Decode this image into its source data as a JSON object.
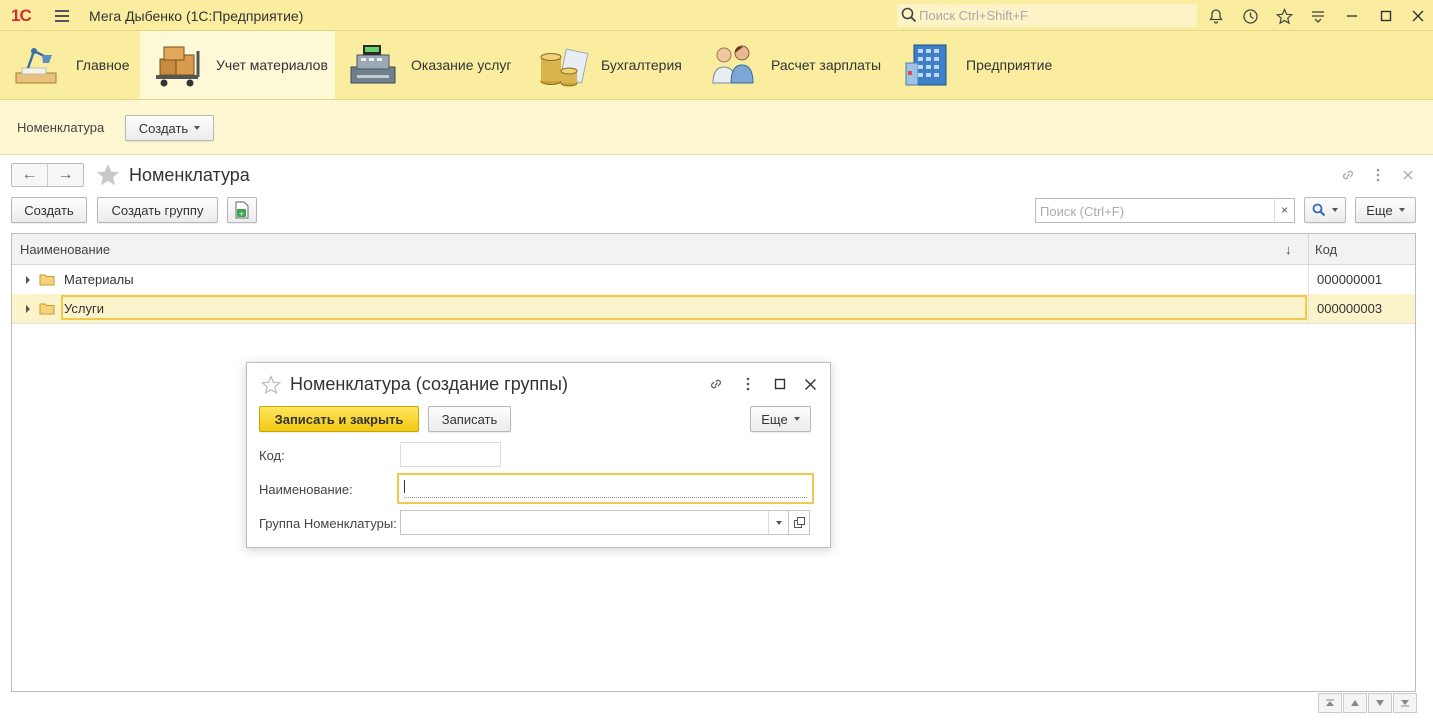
{
  "titlebar": {
    "logo": "1С",
    "title": "Мега Дыбенко  (1С:Предприятие)",
    "search_placeholder": "Поиск Ctrl+Shift+F"
  },
  "sections": [
    {
      "label": "Главное",
      "icon": "desk-lamp-icon"
    },
    {
      "label": "Учет материалов",
      "icon": "boxes-cart-icon",
      "active": true
    },
    {
      "label": "Оказание услуг",
      "icon": "cash-register-icon"
    },
    {
      "label": "Бухгалтерия",
      "icon": "coins-icon"
    },
    {
      "label": "Расчет зарплаты",
      "icon": "people-icon"
    },
    {
      "label": "Предприятие",
      "icon": "building-icon"
    }
  ],
  "subbar": {
    "link": "Номенклатура",
    "create_label": "Создать"
  },
  "form": {
    "title": "Номенклатура",
    "create_label": "Создать",
    "create_group_label": "Создать группу",
    "search_placeholder": "Поиск (Ctrl+F)",
    "clear_label": "×",
    "more_label": "Еще"
  },
  "table": {
    "columns": [
      "Наименование",
      "Код"
    ],
    "sort_indicator": "↓",
    "rows": [
      {
        "name": "Материалы",
        "code": "000000001"
      },
      {
        "name": "Услуги",
        "code": "000000003",
        "selected": true
      }
    ]
  },
  "dialog": {
    "title": "Номенклатура (создание группы)",
    "save_close_label": "Записать и закрыть",
    "save_label": "Записать",
    "more_label": "Еще",
    "fields": {
      "code_label": "Код:",
      "code_value": "",
      "name_label": "Наименование:",
      "name_value": "",
      "group_label": "Группа Номенклатуры:",
      "group_value": ""
    }
  },
  "colors": {
    "panel_yellow": "#fbeda0",
    "accent_yellow": "#f2c94c",
    "button_yellow": "#f3c912"
  }
}
